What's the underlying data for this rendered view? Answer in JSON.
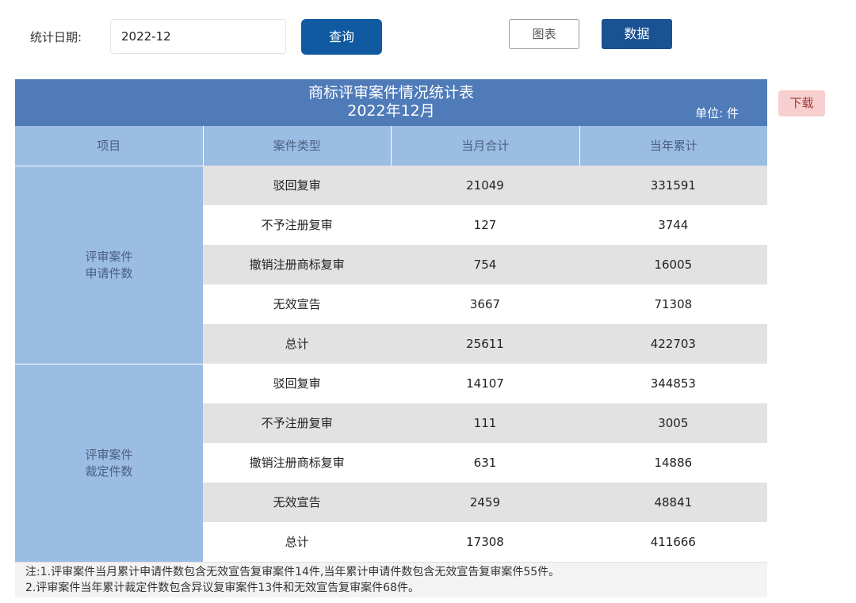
{
  "filter": {
    "label": "统计日期:",
    "date_value": "2022-12",
    "query_label": "查询"
  },
  "view_toggle": {
    "chart_label": "图表",
    "data_label": "数据"
  },
  "download_label": "下载",
  "table": {
    "title": "商标评审案件情况统计表",
    "month": "2022年12月",
    "unit": "单位: 件",
    "columns": [
      "项目",
      "案件类型",
      "当月合计",
      "当年累计"
    ],
    "groups": [
      {
        "label_line1": "评审案件",
        "label_line2": "申请件数",
        "rows": [
          {
            "type": "驳回复审",
            "month": "21049",
            "year": "331591"
          },
          {
            "type": "不予注册复审",
            "month": "127",
            "year": "3744"
          },
          {
            "type": "撤销注册商标复审",
            "month": "754",
            "year": "16005"
          },
          {
            "type": "无效宣告",
            "month": "3667",
            "year": "71308"
          },
          {
            "type": "总计",
            "month": "25611",
            "year": "422703"
          }
        ]
      },
      {
        "label_line1": "评审案件",
        "label_line2": "裁定件数",
        "rows": [
          {
            "type": "驳回复审",
            "month": "14107",
            "year": "344853"
          },
          {
            "type": "不予注册复审",
            "month": "111",
            "year": "3005"
          },
          {
            "type": "撤销注册商标复审",
            "month": "631",
            "year": "14886"
          },
          {
            "type": "无效宣告",
            "month": "2459",
            "year": "48841"
          },
          {
            "type": "总计",
            "month": "17308",
            "year": "411666"
          }
        ]
      }
    ],
    "notes": [
      "注:1.评审案件当月累计申请件数包含无效宣告复审案件14件,当年累计申请件数包含无效宣告复审案件55件。",
      "2.评审案件当年累计裁定件数包含异议复审案件13件和无效宣告复审案件68件。"
    ]
  }
}
